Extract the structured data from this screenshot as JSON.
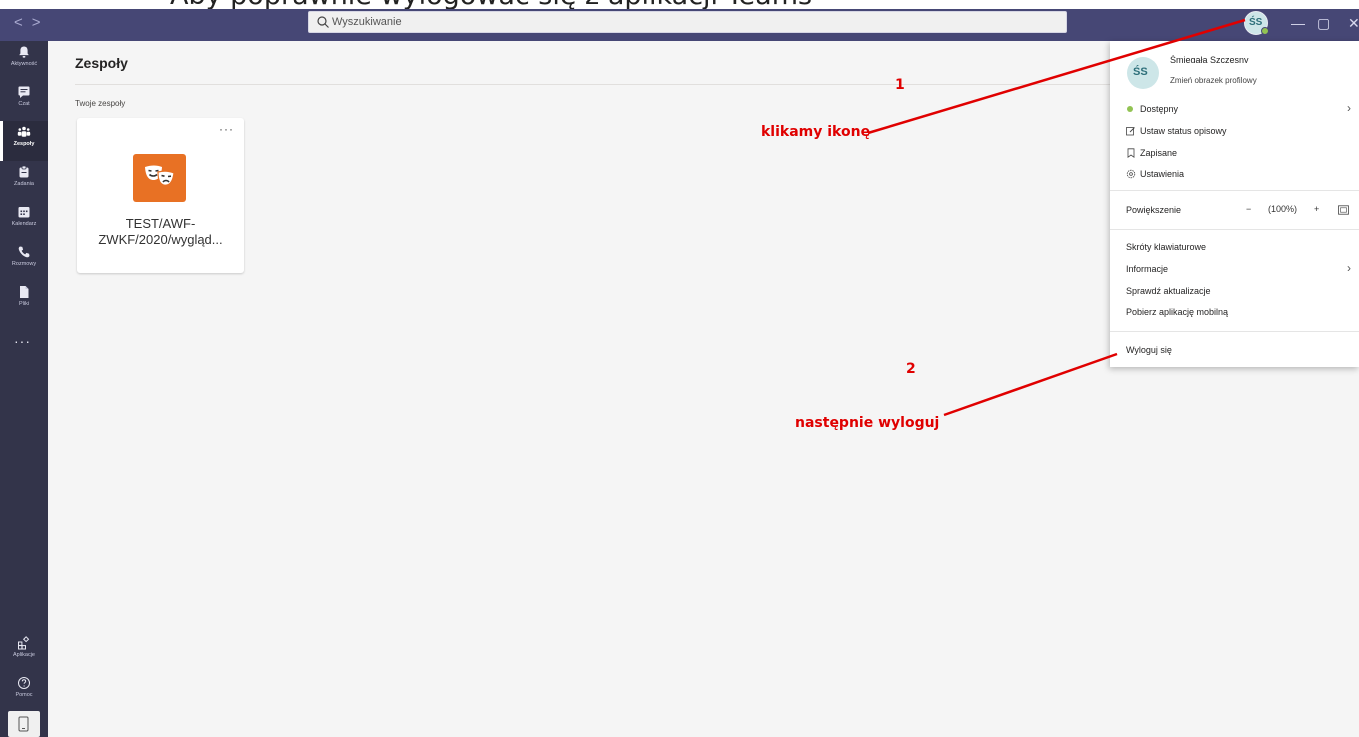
{
  "caption": "Aby poprawnie wylogować się z aplikacji Teams",
  "titlebar": {
    "back_glyph": "<",
    "forward_glyph": ">",
    "search_placeholder": "Wyszukiwanie",
    "avatar_initials": "ŚS",
    "minimize_glyph": "—",
    "maximize_glyph": "▢",
    "close_glyph": "✕"
  },
  "rail": {
    "items": [
      {
        "label": "Aktywność",
        "icon": "bell-icon"
      },
      {
        "label": "Czat",
        "icon": "chat-icon"
      },
      {
        "label": "Zespoły",
        "icon": "teams-icon",
        "active": true
      },
      {
        "label": "Zadania",
        "icon": "assignments-icon"
      },
      {
        "label": "Kalendarz",
        "icon": "calendar-icon"
      },
      {
        "label": "Rozmowy",
        "icon": "phone-icon"
      },
      {
        "label": "Pliki",
        "icon": "files-icon"
      }
    ],
    "more": "···",
    "apps_label": "Aplikacje",
    "help_label": "Pomoc"
  },
  "main": {
    "title": "Zespoły",
    "section_label": "Twoje zespoły",
    "team": {
      "name": "TEST/AWF-ZWKF/2020/wygląd...",
      "menu": "···",
      "color": "#e87124"
    }
  },
  "menu": {
    "user_name": "Śmiegała Szczęsny",
    "change_picture": "Zmień obrazek profilowy",
    "status": "Dostępny",
    "set_status_message": "Ustaw status opisowy",
    "saved": "Zapisane",
    "settings": "Ustawienia",
    "zoom_label": "Powiększenie",
    "zoom_minus": "−",
    "zoom_value": "(100%)",
    "zoom_plus": "+",
    "keyboard_shortcuts": "Skróty klawiaturowe",
    "about": "Informacje",
    "check_updates": "Sprawdź aktualizacje",
    "download_mobile": "Pobierz aplikację mobilną",
    "sign_out": "Wyloguj się"
  },
  "annotations": {
    "step1_number": "1",
    "step1_text": "klikamy ikonę",
    "step2_number": "2",
    "step2_text": "następnie wyloguj",
    "color": "#e00000"
  },
  "colors": {
    "titlebar": "#464775",
    "rail": "#33344a",
    "status_available": "#92c353"
  }
}
